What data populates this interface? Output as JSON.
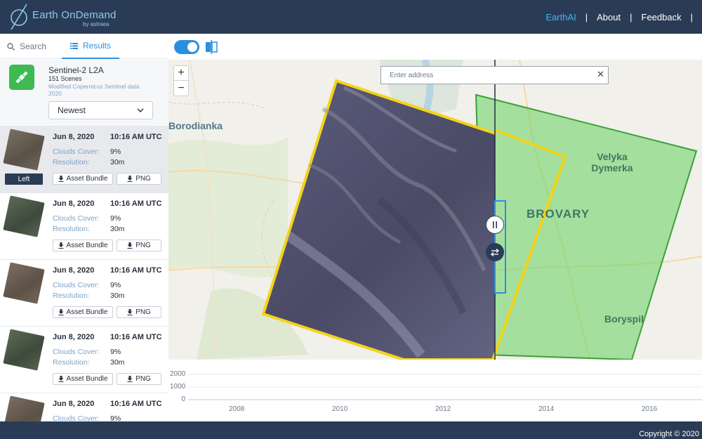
{
  "header": {
    "brand": "Earth OnDemand",
    "brand_sub": "by astraea",
    "nav": [
      "EarthAI",
      "About",
      "Feedback"
    ]
  },
  "tabs": {
    "search": "Search",
    "results": "Results",
    "active": "Results"
  },
  "collection": {
    "name": "Sentinel-2 L2A",
    "count": "151 Scenes",
    "description": "Modified Copernicus Sentinel data 2020",
    "sort_value": "Newest",
    "icon": "satellite-icon"
  },
  "results": [
    {
      "date": "Jun 8, 2020",
      "time": "10:16 AM UTC",
      "clouds_label": "Clouds Cover:",
      "clouds": "9%",
      "res_label": "Resolution:",
      "resolution": "30m",
      "asset_label": "Asset Bundle",
      "png_label": "PNG",
      "left_label": "Left",
      "selected": true,
      "thumb_color": "#6a6056"
    },
    {
      "date": "Jun 8, 2020",
      "time": "10:16 AM UTC",
      "clouds_label": "Clouds Cover:",
      "clouds": "9%",
      "res_label": "Resolution:",
      "resolution": "30m",
      "asset_label": "Asset Bundle",
      "png_label": "PNG",
      "selected": false,
      "thumb_color": "#4e5a4c"
    },
    {
      "date": "Jun 8, 2020",
      "time": "10:16 AM UTC",
      "clouds_label": "Clouds Cover:",
      "clouds": "9%",
      "res_label": "Resolution:",
      "resolution": "30m",
      "asset_label": "Asset Bundle",
      "png_label": "PNG",
      "selected": false,
      "thumb_color": "#6d5f52"
    },
    {
      "date": "Jun 8, 2020",
      "time": "10:16 AM UTC",
      "clouds_label": "Clouds Cover:",
      "clouds": "9%",
      "res_label": "Resolution:",
      "resolution": "30m",
      "asset_label": "Asset Bundle",
      "png_label": "PNG",
      "selected": false,
      "thumb_color": "#4f5c4a"
    },
    {
      "date": "Jun 8, 2020",
      "time": "10:16 AM UTC",
      "clouds_label": "Clouds Cover:",
      "clouds": "9%",
      "selected": false,
      "thumb_color": "#6b6257"
    }
  ],
  "toolbar": {
    "toggle_on": true
  },
  "map": {
    "address_placeholder": "Enter address",
    "places": {
      "borodianka": "Borodianka",
      "velyka": "Velyka Dymerka",
      "brovary": "BROVARY",
      "boryspil": "Boryspil"
    },
    "colors": {
      "left_outline": "#f4d31a",
      "right_fill": "#6fd36a",
      "right_outline": "#3aa23a"
    }
  },
  "timeline": {
    "y_ticks": [
      "2000",
      "1000",
      "0"
    ],
    "x_ticks": [
      "2008",
      "2010",
      "2012",
      "2014",
      "2016"
    ]
  },
  "footer": {
    "copyright": "Copyright © 2020"
  },
  "colors": {
    "header_bg": "#2a3c55",
    "accent": "#2b8fe0",
    "earthai": "#45b4ef"
  }
}
